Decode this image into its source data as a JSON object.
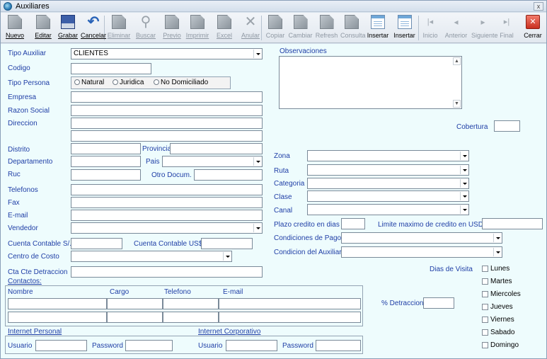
{
  "window": {
    "title": "Auxiliares",
    "close_glyph": "x"
  },
  "toolbar": [
    {
      "id": "nuevo",
      "label": "Nuevo",
      "icon": "new-doc-icon",
      "enabled": true
    },
    {
      "id": "editar",
      "label": "Editar",
      "icon": "edit-doc-icon",
      "enabled": true
    },
    {
      "id": "grabar",
      "label": "Grabar",
      "icon": "save-disk-icon",
      "enabled": true
    },
    {
      "id": "cancelar",
      "label": "Cancelar",
      "icon": "undo-arrow-icon",
      "enabled": true
    },
    {
      "id": "eliminar",
      "label": "Eliminar",
      "icon": "delete-doc-icon",
      "enabled": false
    },
    {
      "id": "buscar",
      "label": "Buscar",
      "icon": "search-icon",
      "enabled": false
    },
    {
      "id": "previo",
      "label": "Previo",
      "icon": "preview-doc-icon",
      "enabled": false
    },
    {
      "id": "imprimir",
      "label": "Imprimir",
      "icon": "printer-icon",
      "enabled": false
    },
    {
      "id": "excel",
      "label": "Excel",
      "icon": "excel-icon",
      "enabled": false
    },
    {
      "id": "anular",
      "label": "Anular",
      "icon": "void-x-icon",
      "enabled": false
    },
    {
      "id": "copiar",
      "label": "Copiar",
      "icon": "copy-icon",
      "enabled": false
    },
    {
      "id": "cambiar",
      "label": "Cambiar",
      "icon": "change-icon",
      "enabled": false
    },
    {
      "id": "refresh",
      "label": "Refresh",
      "icon": "refresh-icon",
      "enabled": false
    },
    {
      "id": "consulta",
      "label": "Consulta",
      "icon": "query-icon",
      "enabled": false
    },
    {
      "id": "insertar1",
      "label": "Insertar",
      "icon": "insert-doc-icon",
      "enabled": true
    },
    {
      "id": "insertar2",
      "label": "Insertar",
      "icon": "insert-doc-icon",
      "enabled": true
    },
    {
      "id": "inicio",
      "label": "Inicio",
      "icon": "first-record-icon",
      "enabled": false
    },
    {
      "id": "anterior",
      "label": "Anterior",
      "icon": "previous-record-icon",
      "enabled": false
    },
    {
      "id": "siguiente",
      "label": "Siguiente",
      "icon": "next-record-icon",
      "enabled": false
    },
    {
      "id": "final",
      "label": "Final",
      "icon": "last-record-icon",
      "enabled": false
    },
    {
      "id": "cerrar",
      "label": "Cerrar",
      "icon": "close-red-icon",
      "enabled": true
    }
  ],
  "form": {
    "tipo_auxiliar": {
      "label": "Tipo Auxiliar",
      "value": "CLIENTES"
    },
    "codigo": {
      "label": "Codigo",
      "value": ""
    },
    "tipo_persona": {
      "label": "Tipo Persona",
      "options": [
        "Natural",
        "Juridica",
        "No Domiciliado"
      ]
    },
    "empresa": {
      "label": "Empresa"
    },
    "razon_social": {
      "label": "Razon Social"
    },
    "direccion": {
      "label": "Direccion"
    },
    "distrito": {
      "label": "Distrito"
    },
    "provincia": {
      "label": "Provincia"
    },
    "departamento": {
      "label": "Departamento"
    },
    "pais": {
      "label": "Pais"
    },
    "ruc": {
      "label": "Ruc"
    },
    "otro_docum": {
      "label": "Otro Docum."
    },
    "telefonos": {
      "label": "Telefonos"
    },
    "fax": {
      "label": "Fax"
    },
    "email": {
      "label": "E-mail"
    },
    "vendedor": {
      "label": "Vendedor"
    },
    "cuenta_soles": {
      "label": "Cuenta Contable S/."
    },
    "cuenta_usd": {
      "label": "Cuenta Contable US$"
    },
    "centro_costo": {
      "label": "Centro de Costo"
    },
    "cta_detraccion": {
      "label": "Cta Cte Detraccion"
    },
    "observaciones": {
      "label": "Observaciones"
    },
    "cobertura": {
      "label": "Cobertura"
    },
    "zona": {
      "label": "Zona"
    },
    "ruta": {
      "label": "Ruta"
    },
    "categoria": {
      "label": "Categoria"
    },
    "clase": {
      "label": "Clase"
    },
    "canal": {
      "label": "Canal"
    },
    "plazo_credito": {
      "label": "Plazo credito en dias"
    },
    "limite_credito": {
      "label": "Limite maximo de credito en USD"
    },
    "condiciones_pago": {
      "label": "Condiciones de Pago"
    },
    "condicion_auxiliar": {
      "label": "Condicion del Auxiliar"
    },
    "dias_visita": {
      "label": "Dias de Visita",
      "days": [
        "Lunes",
        "Martes",
        "Miercoles",
        "Jueves",
        "Viernes",
        "Sabado",
        "Domingo"
      ]
    },
    "detraccion_pct": {
      "label": "% Detraccion"
    }
  },
  "contactos": {
    "title": "Contactos:",
    "columns": [
      "Nombre",
      "Cargo",
      "Telefono",
      "E-mail"
    ]
  },
  "internet_personal": {
    "title": "Internet Personal",
    "usuario_label": "Usuario",
    "password_label": "Password"
  },
  "internet_corporativo": {
    "title": "Internet Corporativo",
    "usuario_label": "Usuario",
    "password_label": "Password"
  }
}
